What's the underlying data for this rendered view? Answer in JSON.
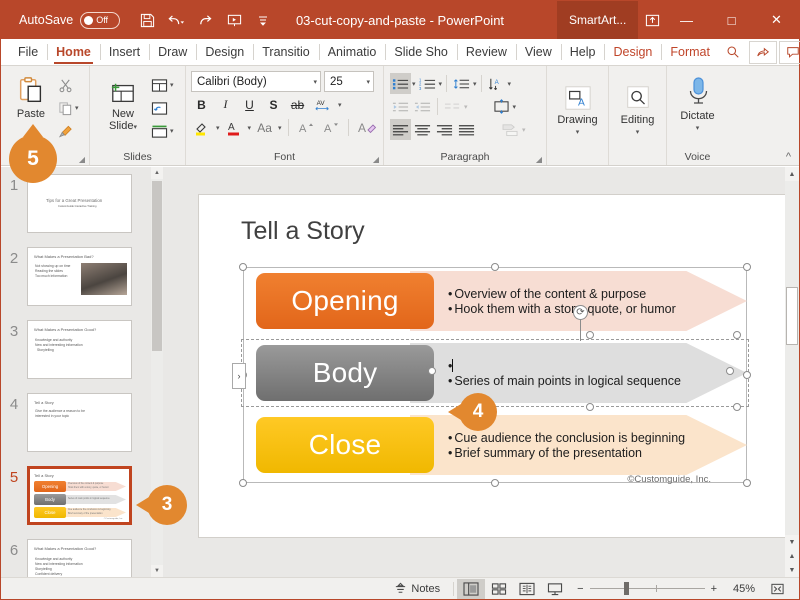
{
  "titlebar": {
    "autosave_label": "AutoSave",
    "autosave_state": "Off",
    "document_title": "03-cut-copy-and-paste  -  PowerPoint",
    "contextual_tab": "SmartArt...",
    "quick_access": [
      {
        "name": "save-icon",
        "tooltip": "Save"
      },
      {
        "name": "undo-icon",
        "tooltip": "Undo"
      },
      {
        "name": "redo-icon",
        "tooltip": "Redo"
      },
      {
        "name": "start-slideshow-icon",
        "tooltip": "Start From Beginning"
      },
      {
        "name": "customize-qat-icon",
        "tooltip": "Customize Quick Access Toolbar"
      }
    ],
    "window_buttons": [
      {
        "name": "minimize-button",
        "glyph": "—"
      },
      {
        "name": "maximize-button",
        "glyph": "□"
      },
      {
        "name": "close-button",
        "glyph": "✕"
      }
    ]
  },
  "tabs": [
    {
      "label": "File",
      "state": "normal"
    },
    {
      "label": "Home",
      "state": "active"
    },
    {
      "label": "Insert",
      "state": "normal"
    },
    {
      "label": "Draw",
      "state": "normal"
    },
    {
      "label": "Design",
      "state": "normal"
    },
    {
      "label": "Transitio",
      "state": "normal"
    },
    {
      "label": "Animatio",
      "state": "normal"
    },
    {
      "label": "Slide Sho",
      "state": "normal"
    },
    {
      "label": "Review",
      "state": "normal"
    },
    {
      "label": "View",
      "state": "normal"
    },
    {
      "label": "Help",
      "state": "normal"
    },
    {
      "label": "Design",
      "state": "contextual"
    },
    {
      "label": "Format",
      "state": "contextual"
    }
  ],
  "tabstrip_right": [
    {
      "name": "tell-me-search-icon"
    },
    {
      "name": "share-icon"
    },
    {
      "name": "comments-icon"
    }
  ],
  "ribbon": {
    "clipboard": {
      "group_label": "ard",
      "paste_label": "Paste",
      "cut_label": "Cut",
      "copy_label": "Copy",
      "format_painter_label": "Format Painter"
    },
    "slides": {
      "group_label": "Slides",
      "new_slide_label": "New\nSlide",
      "new_slide_line1": "New",
      "new_slide_line2": "Slide",
      "layout_label": "Layout",
      "reset_label": "Reset",
      "section_label": "Section"
    },
    "font": {
      "group_label": "Font",
      "font_family": "Calibri (Body)",
      "font_size": "25",
      "bold": "B",
      "italic": "I",
      "underline": "U",
      "shadow": "S",
      "strikethrough": "ab",
      "character_spacing": "AV",
      "text_highlight": "✎",
      "font_color": "A",
      "change_case": "Aa",
      "increase_size": "A",
      "decrease_size": "A",
      "clear_formatting": "A"
    },
    "paragraph": {
      "group_label": "Paragraph",
      "bullets": "Bullets",
      "numbering": "Numbering",
      "line_spacing": "Line Spacing",
      "text_direction": "Text Direction",
      "decrease_indent": "Decrease Indent",
      "increase_indent": "Increase Indent",
      "columns": "Columns",
      "align_text": "Align Text",
      "align_left": "Align Left",
      "align_center": "Center",
      "align_right": "Align Right",
      "justify": "Justify",
      "convert_to_smartart": "Convert to SmartArt"
    },
    "drawing": {
      "label": "Drawing"
    },
    "editing": {
      "label": "Editing"
    },
    "voice": {
      "group_label": "Voice",
      "dictate_label": "Dictate"
    },
    "collapse_ribbon": "^"
  },
  "thumbnails": [
    {
      "number": "1",
      "title": "Tips for a Great Presentation",
      "subtitle": "CustomGuide Interactive Training",
      "selected": false,
      "type": "title"
    },
    {
      "number": "2",
      "title": "What Makes a Presentation Bad?",
      "bullets": [
        "Not showing up on time",
        "Reading the slides",
        "Too much information"
      ],
      "selected": false,
      "type": "image"
    },
    {
      "number": "3",
      "title": "What Makes a Presentation Good?",
      "bullets": [
        "Knowledge and authority",
        "New and interesting information",
        "Storytelling"
      ],
      "selected": false,
      "type": "bullets"
    },
    {
      "number": "4",
      "title": "Tell a Story",
      "bullets": [
        "Give the audience a reason to be interested in your topic"
      ],
      "selected": false,
      "type": "bullets"
    },
    {
      "number": "5",
      "title": "Tell a Story",
      "selected": true,
      "type": "smartart"
    },
    {
      "number": "6",
      "title": "What Makes a Presentation Good?",
      "bullets": [
        "Knowledge and authority",
        "New and interesting information",
        "Storytelling",
        "Confident delivery"
      ],
      "selected": false,
      "type": "bullets"
    }
  ],
  "slide": {
    "title": "Tell a Story",
    "copyright": "©Customguide, Inc.",
    "smartart": {
      "rows": [
        {
          "label": "Opening",
          "chip_color_top": "#f08030",
          "chip_color_bottom": "#e2661a",
          "arrow_color": "#f7ddd3",
          "bullets": [
            "Overview of the content & purpose",
            "Hook them with a story, quote, or humor"
          ],
          "editing": false
        },
        {
          "label": "Body",
          "chip_color_top": "#8f8f8f",
          "chip_color_bottom": "#6f6f6f",
          "arrow_color": "#dedede",
          "bullets": [
            "",
            "Series of main points in logical sequence"
          ],
          "editing": true
        },
        {
          "label": "Close",
          "chip_color_top": "#ffc925",
          "chip_color_bottom": "#f0b800",
          "arrow_color": "#fbe4cb",
          "bullets": [
            "Cue audience the conclusion is beginning",
            "Brief summary of the presentation"
          ],
          "editing": false
        }
      ],
      "text_pane_toggle": "›"
    }
  },
  "statusbar": {
    "notes_label": "Notes",
    "views": [
      {
        "name": "normal-view-button",
        "active": true
      },
      {
        "name": "slide-sorter-view-button",
        "active": false
      },
      {
        "name": "reading-view-button",
        "active": false
      },
      {
        "name": "slideshow-view-button",
        "active": false
      }
    ],
    "zoom_out": "−",
    "zoom_in": "+",
    "zoom_value": "45%",
    "fit_to_window": "fit-slide-icon"
  },
  "callouts": [
    {
      "number": "3",
      "target": "slide-thumbnail-5"
    },
    {
      "number": "4",
      "target": "smartart-body-text-cursor"
    },
    {
      "number": "5",
      "target": "paste-button"
    }
  ],
  "colors": {
    "accent": "#b8472a",
    "badge": "#e2882f",
    "selection": "#c0441f"
  }
}
